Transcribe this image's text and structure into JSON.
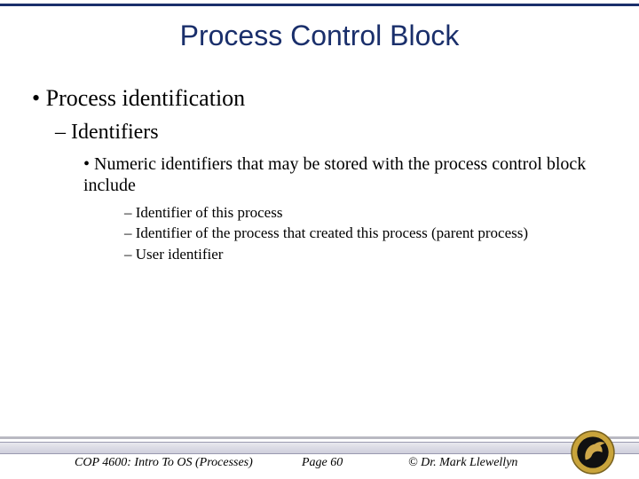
{
  "title": "Process Control Block",
  "bullets": {
    "l1": "Process identification",
    "l2": "Identifiers",
    "l3": "Numeric identifiers that may be stored with the process control block include",
    "l4a": "Identifier of this process",
    "l4b": "Identifier of the process that created this process (parent process)",
    "l4c": "User identifier"
  },
  "footer": {
    "course": "COP 4600: Intro To OS  (Processes)",
    "page": "Page 60",
    "copyright": "© Dr. Mark Llewellyn"
  }
}
